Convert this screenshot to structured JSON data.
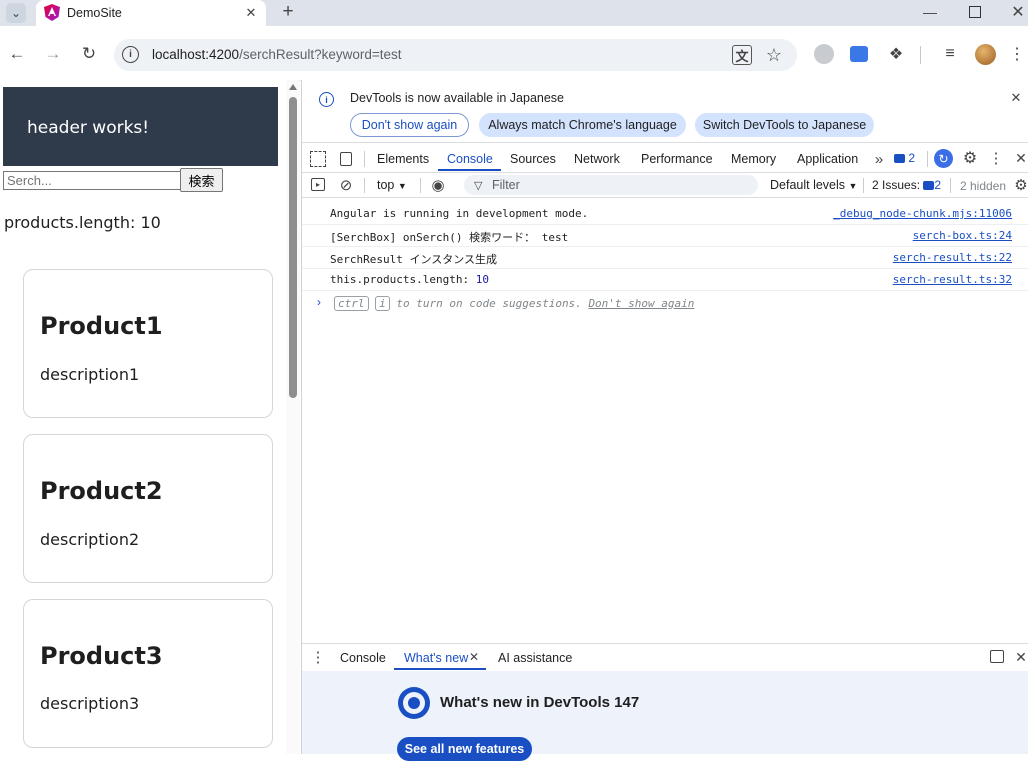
{
  "browser": {
    "tab_title": "DemoSite",
    "new_tab_symbol": "+",
    "url_host": "localhost:4200",
    "url_path": "/serchResult?keyword=test",
    "window_controls": [
      "minimize-icon",
      "maximize-icon",
      "close-icon"
    ]
  },
  "page": {
    "header_text": "header works!",
    "search_placeholder": "Serch...",
    "search_button": "検索",
    "products_count_label": "products.length: 10",
    "products": [
      {
        "title": "Product1",
        "description": "description1"
      },
      {
        "title": "Product2",
        "description": "description2"
      },
      {
        "title": "Product3",
        "description": "description3"
      }
    ]
  },
  "devtools": {
    "banner": {
      "message": "DevTools is now available in Japanese",
      "btn_dont_show": "Don't show again",
      "btn_match": "Always match Chrome's language",
      "btn_switch": "Switch DevTools to Japanese"
    },
    "tabs": [
      "Elements",
      "Console",
      "Sources",
      "Network",
      "Performance",
      "Memory",
      "Application"
    ],
    "active_tab": "Console",
    "issue_badge": "2",
    "console_toolbar": {
      "context": "top",
      "filter_placeholder": "Filter",
      "levels": "Default levels",
      "issues_label": "2 Issues:",
      "issues_count": "2",
      "hidden": "2 hidden"
    },
    "messages": [
      {
        "text": "Angular is running in development mode.",
        "value": "",
        "source": "_debug_node-chunk.mjs:11006"
      },
      {
        "text": "[SerchBox] onSerch() 検索ワード： test",
        "value": "",
        "source": "serch-box.ts:24"
      },
      {
        "text": "SerchResult インスタンス生成",
        "value": "",
        "source": "serch-result.ts:22"
      },
      {
        "text": "this.products.length: ",
        "value": "10",
        "source": "serch-result.ts:32"
      }
    ],
    "prompt_hint": {
      "key1": "ctrl",
      "key2": "i",
      "text": "to turn on code suggestions.",
      "dont_show": "Don't show again"
    },
    "drawer": {
      "tabs": [
        "Console",
        "What's new",
        "AI assistance"
      ],
      "active": "What's new",
      "whats_new_title": "What's new in DevTools 147",
      "see_all": "See all new features"
    }
  },
  "colors": {
    "header_bg": "#2f3a4a",
    "active_blue": "#1a4fc4",
    "pill_bg": "#d3e3fd",
    "tabstrip_bg": "#dee3eb"
  }
}
